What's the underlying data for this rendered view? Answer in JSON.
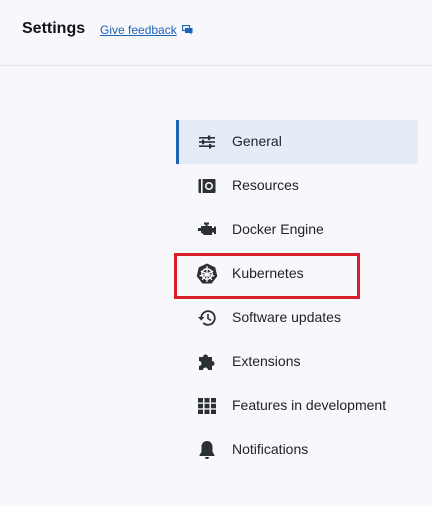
{
  "header": {
    "title": "Settings",
    "feedback_label": "Give feedback",
    "feedback_icon": "chat-bubble-icon"
  },
  "colors": {
    "accent": "#1d63b7",
    "active_bg": "#e4ecf7",
    "highlight": "#d71f2b",
    "background": "#f8f7fb"
  },
  "nav": {
    "items": [
      {
        "label": "General",
        "icon": "sliders-icon",
        "active": true
      },
      {
        "label": "Resources",
        "icon": "resources-icon",
        "active": false
      },
      {
        "label": "Docker Engine",
        "icon": "engine-icon",
        "active": false
      },
      {
        "label": "Kubernetes",
        "icon": "kubernetes-icon",
        "active": false,
        "highlighted": true
      },
      {
        "label": "Software updates",
        "icon": "history-icon",
        "active": false
      },
      {
        "label": "Extensions",
        "icon": "puzzle-icon",
        "active": false
      },
      {
        "label": "Features in development",
        "icon": "grid-icon",
        "active": false
      },
      {
        "label": "Notifications",
        "icon": "bell-icon",
        "active": false
      }
    ]
  }
}
